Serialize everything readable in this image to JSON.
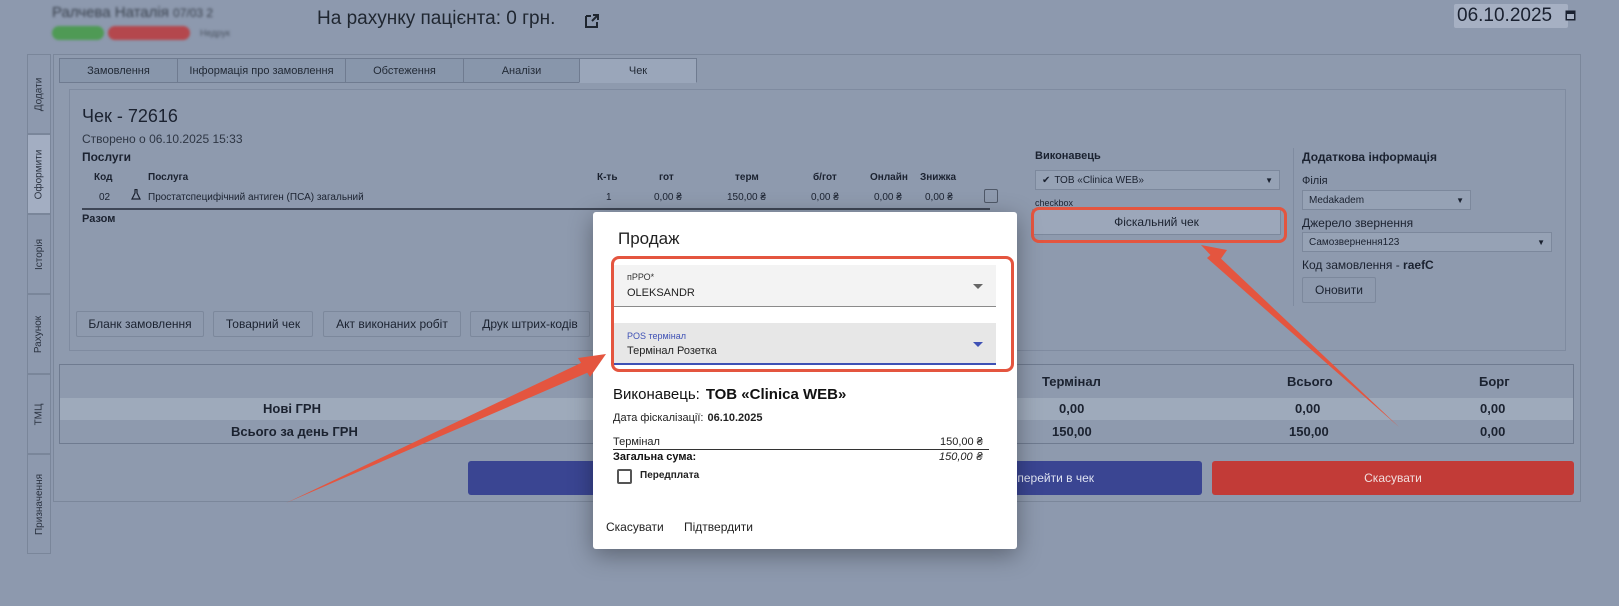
{
  "header": {
    "patient_name": "Ралчева Наталія",
    "patient_meta": "07/03 2",
    "badges": [
      "",
      "",
      "Недрук"
    ],
    "balance_text": "На рахунку пацієнта: 0 грн.",
    "date": "06.10.2025"
  },
  "side_tabs": [
    "Додати",
    "Оформити",
    "Історія",
    "Рахунок",
    "ТМЦ",
    "Призначення"
  ],
  "top_tabs": [
    "Замовлення",
    "Інформація про замовлення",
    "Обстеження",
    "Аналізи",
    "Чек"
  ],
  "check": {
    "title": "Чек - 72616",
    "created": "Створено о 06.10.2025 15:33",
    "services_label": "Послуги",
    "columns": [
      "Код",
      "Послуга",
      "К-ть",
      "гот",
      "терм",
      "б/гот",
      "Онлайн",
      "Знижка"
    ],
    "row": [
      "02",
      "Простатспецифічний антиген (ПСА) загальний",
      "1",
      "0,00 ₴",
      "150,00 ₴",
      "0,00 ₴",
      "0,00 ₴",
      "0,00 ₴"
    ],
    "total_label": "Разом"
  },
  "action_buttons": [
    "Бланк замовлення",
    "Товарний чек",
    "Акт виконаних робіт",
    "Друк штрих-кодів"
  ],
  "executor": {
    "label": "Виконавець",
    "value": "ТОВ «Clinica WEB»",
    "checkbox_label": "checkbox",
    "fiscal_button": "Фіскальний чек"
  },
  "extra_info": {
    "label": "Додаткова інформація",
    "branch_label": "Філія",
    "branch_value": "Medakadem",
    "source_label": "Джерело звернення",
    "source_value": "Самозвернення123",
    "order_code_label": "Код замовлення -",
    "order_code": "raefC",
    "refresh_button": "Оновити"
  },
  "totals": {
    "headers": [
      "Термінал",
      "Всього",
      "Борг"
    ],
    "rows": [
      {
        "label": "Нові ГРН",
        "values": [
          "0,00",
          "0,00",
          "0,00"
        ]
      },
      {
        "label": "Всього за день ГРН",
        "values": [
          "150,00",
          "150,00",
          "0,00"
        ]
      }
    ]
  },
  "bottom_buttons": {
    "go_to_check": "перейти в чек",
    "cancel": "Скасувати"
  },
  "modal": {
    "title": "Продаж",
    "prro_label": "пРРО*",
    "prro_value": "OLEKSANDR",
    "pos_label": "POS термінал",
    "pos_value": "Термінал Розетка",
    "executor_label": "Виконавець:",
    "executor_value": "ТОВ «Clinica WEB»",
    "fiscal_date_label": "Дата фіскалізації:",
    "fiscal_date": "06.10.2025",
    "terminal_label": "Термінал",
    "terminal_value": "150,00 ₴",
    "sum_label": "Загальна сума:",
    "sum_value": "150,00 ₴",
    "prepay_label": "Передплата",
    "cancel_button": "Скасувати",
    "confirm_button": "Підтвердити"
  },
  "colors": {
    "overlay": "#8d99ae",
    "highlight": "#e4553f",
    "primary_button": "#3a4592",
    "danger_button": "#c23b37",
    "focus": "#3f51b5"
  }
}
